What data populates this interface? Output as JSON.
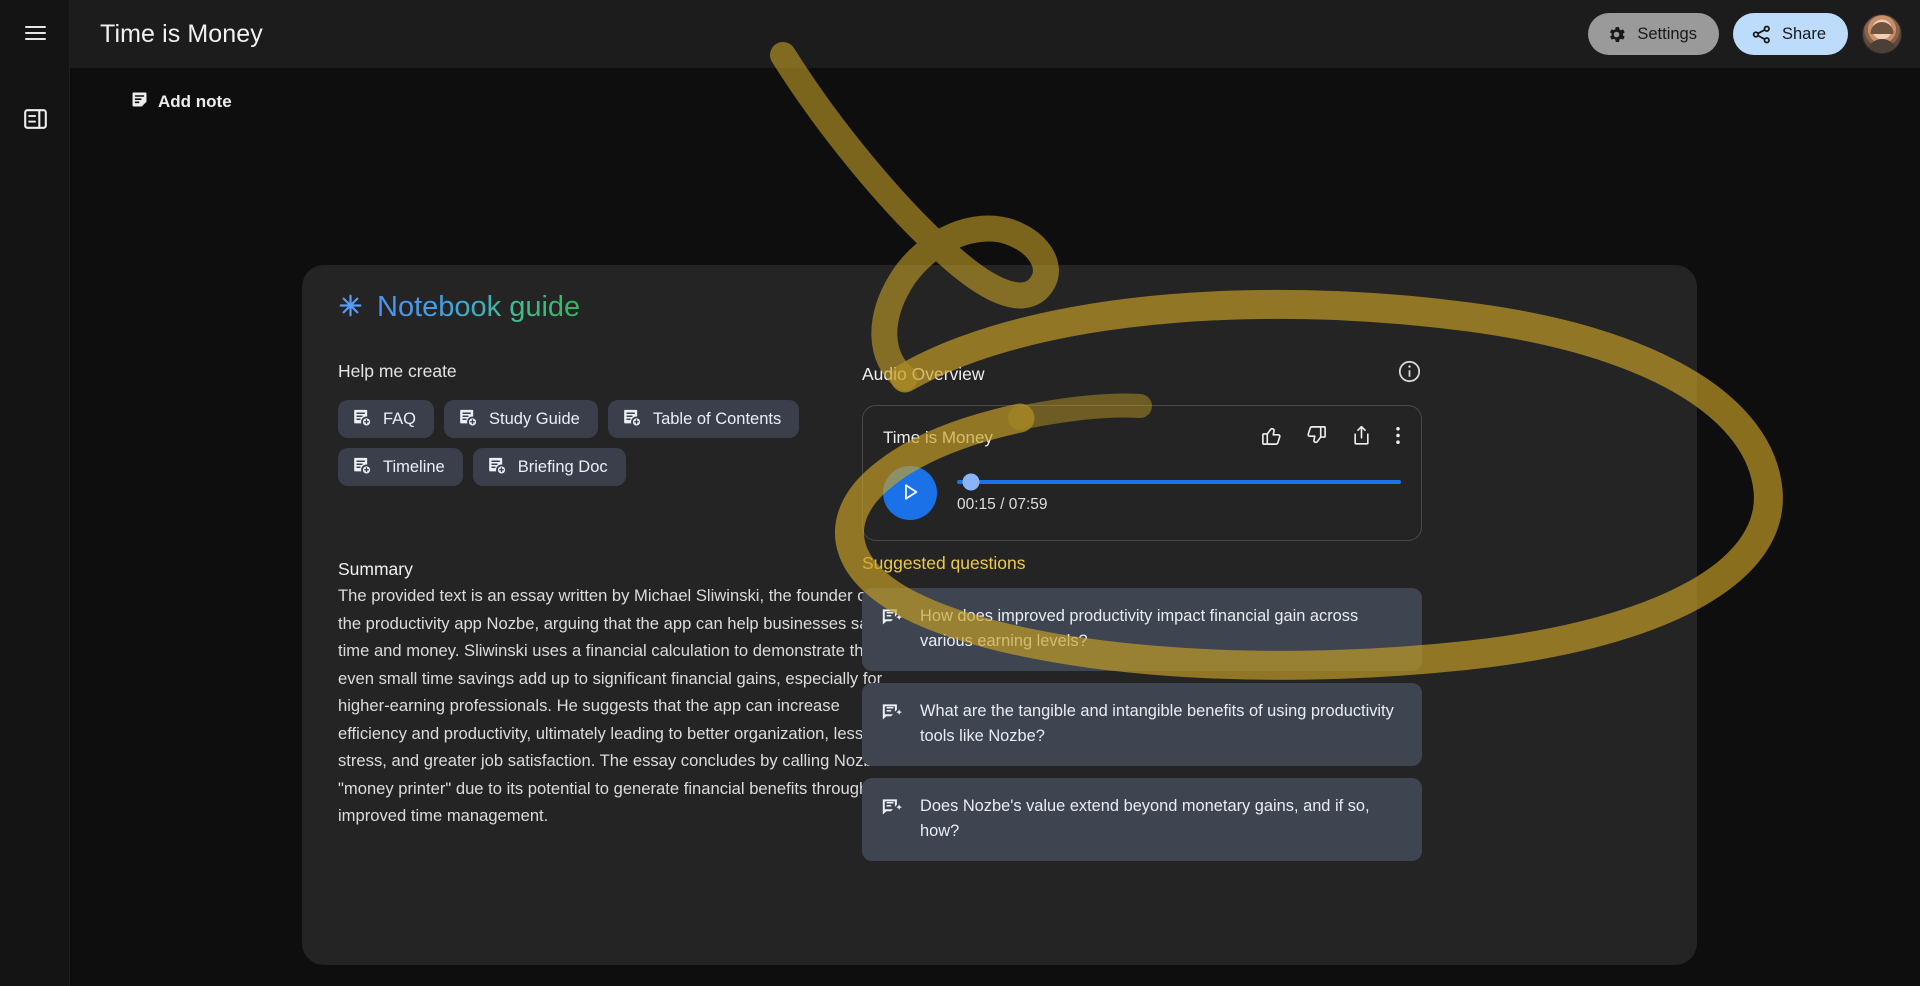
{
  "window": {
    "title": "Time is Money"
  },
  "rail": {
    "menu_label": "Main menu",
    "panel_label": "Toggle panel"
  },
  "topbar": {
    "settings_label": "Settings",
    "share_label": "Share",
    "avatar_label": "Account"
  },
  "toolbar": {
    "add_note_label": "Add note"
  },
  "guide": {
    "title": "Notebook guide",
    "help_me_create_label": "Help me create",
    "chips": [
      {
        "label": "FAQ"
      },
      {
        "label": "Study Guide"
      },
      {
        "label": "Table of Contents"
      },
      {
        "label": "Timeline"
      },
      {
        "label": "Briefing Doc"
      }
    ],
    "summary": {
      "title": "Summary",
      "text": "The provided text is an essay written by Michael Sliwinski, the founder of the productivity app Nozbe, arguing that the app can help businesses save time and money. Sliwinski uses a financial calculation to demonstrate that even small time savings add up to significant financial gains, especially for higher-earning professionals. He suggests that the app can increase efficiency and productivity, ultimately leading to better organization, less stress, and greater job satisfaction. The essay concludes by calling Nozbe a \"money printer\" due to its potential to generate financial benefits through improved time management."
    }
  },
  "audio_overview": {
    "label": "Audio Overview",
    "info_label": "About Audio Overview",
    "player": {
      "title": "Time is Money",
      "current_time": "00:15",
      "total_time": "07:59",
      "time_display": "00:15 / 07:59",
      "progress_percent": 3.1,
      "play_label": "Play",
      "thumbs_up_label": "Like",
      "thumbs_down_label": "Dislike",
      "share_label": "Share",
      "more_label": "More options"
    }
  },
  "suggested_questions": {
    "label": "Suggested questions",
    "items": [
      {
        "text": "How does improved productivity impact financial gain across various earning levels?"
      },
      {
        "text": "What are the tangible and intangible benefits of using productivity tools like Nozbe?"
      },
      {
        "text": "Does Nozbe's value extend beyond monetary gains, and if so, how?"
      }
    ]
  },
  "colors": {
    "accent_blue": "#1b72e8",
    "share_pill": "#bddcfb",
    "settings_pill": "#9a9a9a",
    "annotation_yellow": "#c9a227",
    "suggested_label": "#f0c949",
    "card_bg": "#3e4450",
    "panel_bg": "#242424"
  },
  "icons": {
    "menu": "hamburger-icon",
    "panel": "side-panel-icon",
    "settings": "gear-icon",
    "share": "share-icon",
    "add_note": "note-icon",
    "chip": "note-add-icon",
    "sparkle": "sparkle-asterisk-icon",
    "info": "info-circle-icon",
    "thumb_up": "thumbs-up-icon",
    "thumb_down": "thumbs-down-icon",
    "player_share": "share-upload-icon",
    "more": "more-vertical-icon",
    "play": "play-icon",
    "question": "chat-sparkle-icon"
  }
}
